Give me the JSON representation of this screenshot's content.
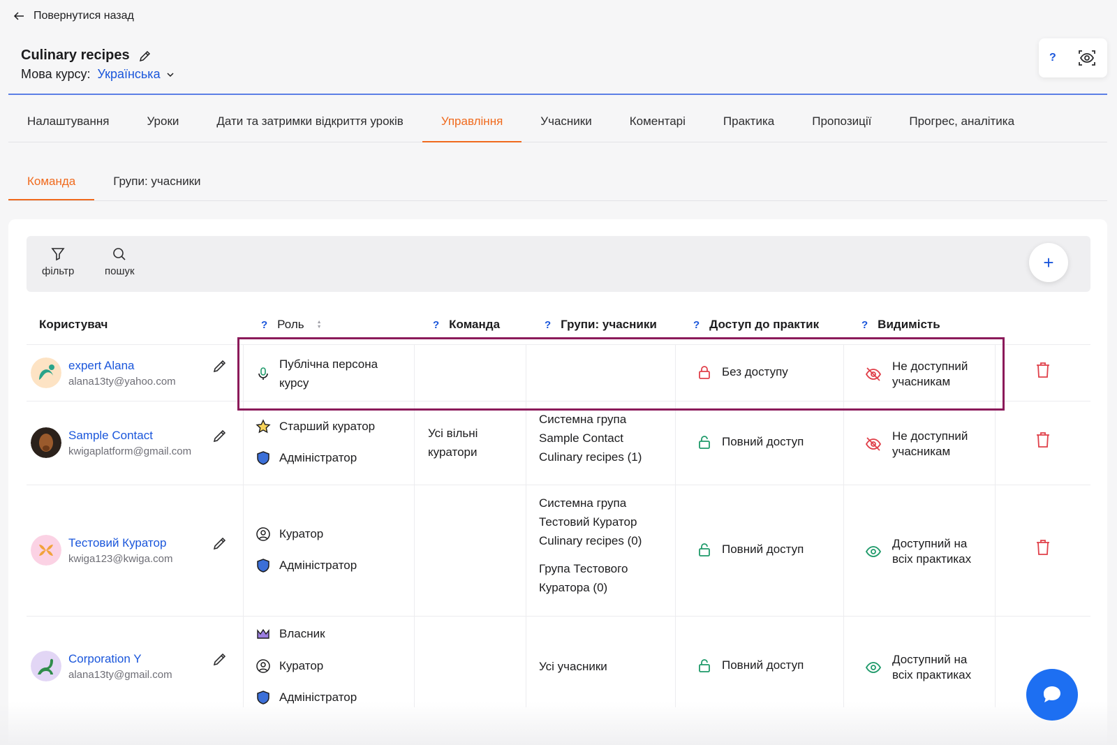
{
  "header": {
    "back_label": "Повернутися назад",
    "course_title": "Culinary recipes",
    "language_label": "Мова курсу:",
    "language_value": "Українська",
    "help_label": "?"
  },
  "tabs": [
    {
      "label": "Налаштування",
      "active": false
    },
    {
      "label": "Уроки",
      "active": false
    },
    {
      "label": "Дати та затримки відкриття уроків",
      "active": false
    },
    {
      "label": "Управління",
      "active": true
    },
    {
      "label": "Учасники",
      "active": false
    },
    {
      "label": "Коментарі",
      "active": false
    },
    {
      "label": "Практика",
      "active": false
    },
    {
      "label": "Пропозиції",
      "active": false
    },
    {
      "label": "Прогрес, аналітика",
      "active": false
    }
  ],
  "subtabs": [
    {
      "label": "Команда",
      "active": true
    },
    {
      "label": "Групи: учасники",
      "active": false
    }
  ],
  "toolbar": {
    "filter_label": "фільтр",
    "search_label": "пошук",
    "add_label": "+"
  },
  "table": {
    "help": "?",
    "headers": {
      "user": "Користувач",
      "role": "Роль",
      "team": "Команда",
      "groups": "Групи: учасники",
      "practice_access": "Доступ до практик",
      "visibility": "Видимість"
    },
    "rows": [
      {
        "name": "expert Alana",
        "email": "alana13ty@yahoo.com",
        "role_1": "Публічна персона",
        "role_1b": "курсу",
        "access": "Без доступу",
        "visibility_1": "Не доступний",
        "visibility_2": "учасникам"
      },
      {
        "name": "Sample Contact",
        "email": "kwigaplatform@gmail.com",
        "role_1": "Старший куратор",
        "role_2": "Адміністратор",
        "team_1": "Усі вільні",
        "team_2": "куратори",
        "group_1": "Системна група",
        "group_2": "Sample Contact",
        "group_3": "Culinary recipes (1)",
        "access": "Повний доступ",
        "visibility_1": "Не доступний",
        "visibility_2": "учасникам"
      },
      {
        "name": "Тестовий Куратор",
        "email": "kwiga123@kwiga.com",
        "role_1": "Куратор",
        "role_2": "Адміністратор",
        "group_1": "Системна група",
        "group_2": "Тестовий Куратор",
        "group_3": "Culinary recipes (0)",
        "group_4": "Група Тестового",
        "group_5": "Куратора (0)",
        "access": "Повний доступ",
        "visibility_1": "Доступний на",
        "visibility_2": "всіх практиках"
      },
      {
        "name": "Corporation Y",
        "email": "alana13ty@gmail.com",
        "role_1": "Власник",
        "role_2": "Куратор",
        "role_3": "Адміністратор",
        "group_1": "Усі учасники",
        "access": "Повний доступ",
        "visibility_1": "Доступний на",
        "visibility_2": "всіх практиках"
      }
    ]
  },
  "colors": {
    "accent_orange": "#f06a1d",
    "link_blue": "#1a56db",
    "danger_red": "#e0404a",
    "success_green": "#1f9a6a",
    "highlight": "#8b1a5a"
  }
}
